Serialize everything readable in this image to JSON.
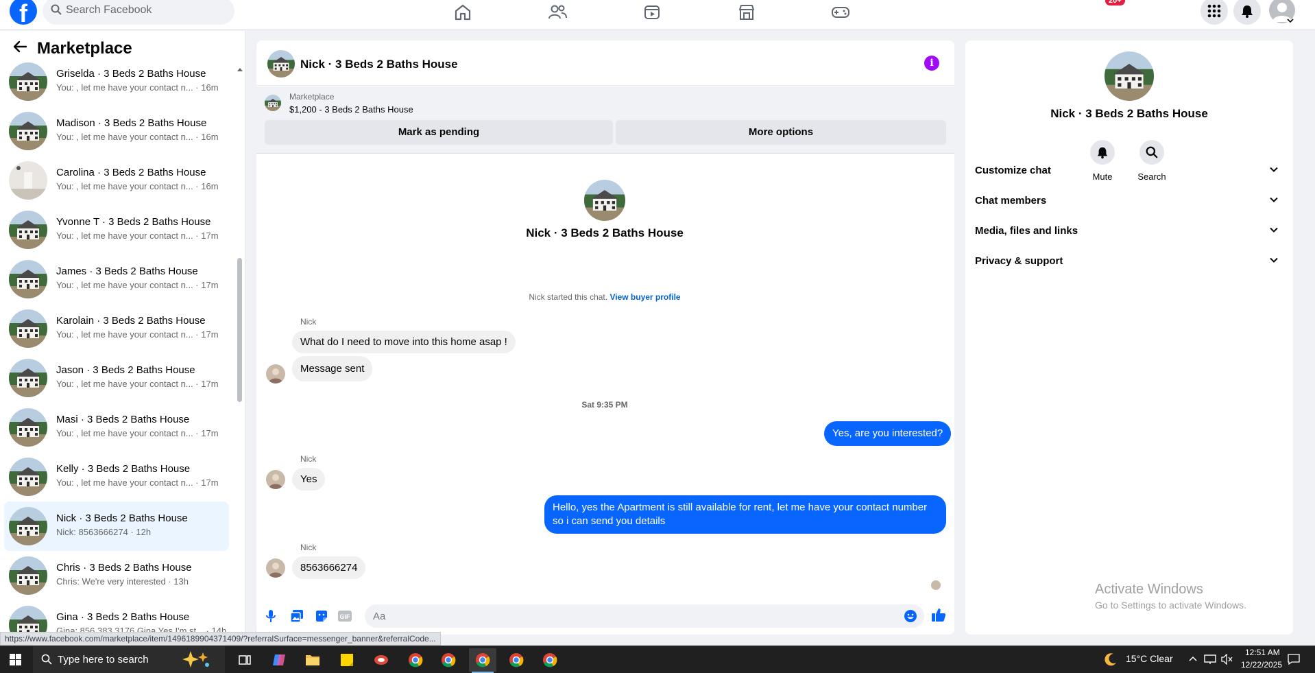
{
  "topbar": {
    "logo_letter": "f",
    "search_placeholder": "Search Facebook",
    "notification_badge": "20+",
    "nav_icons": [
      "home-icon",
      "friends-icon",
      "video-icon",
      "marketplace-icon",
      "gaming-icon"
    ]
  },
  "sidebar": {
    "title": "Marketplace",
    "conversations": [
      {
        "title": "Griselda · 3 Beds 2 Baths House",
        "subtitle": "You: , let me have your contact n... · 16m",
        "active": false
      },
      {
        "title": "Madison · 3 Beds 2 Baths House",
        "subtitle": "You: , let me have your contact n... · 16m",
        "active": false
      },
      {
        "title": "Carolina · 3 Beds 2 Baths House",
        "subtitle": "You: , let me have your contact n... · 16m",
        "active": false
      },
      {
        "title": "Yvonne T · 3 Beds 2 Baths House",
        "subtitle": "You: , let me have your contact n... · 17m",
        "active": false
      },
      {
        "title": "James · 3 Beds 2 Baths House",
        "subtitle": "You: , let me have your contact n... · 17m",
        "active": false
      },
      {
        "title": "Karolain · 3 Beds 2 Baths House",
        "subtitle": "You: , let me have your contact n... · 17m",
        "active": false
      },
      {
        "title": "Jason · 3 Beds 2 Baths House",
        "subtitle": "You: , let me have your contact n... · 17m",
        "active": false
      },
      {
        "title": "Masi · 3 Beds 2 Baths House",
        "subtitle": "You: , let me have your contact n... · 17m",
        "active": false
      },
      {
        "title": "Kelly · 3 Beds 2 Baths House",
        "subtitle": "You: , let me have your contact n... · 17m",
        "active": false
      },
      {
        "title": "Nick · 3 Beds 2 Baths House",
        "subtitle": "Nick: 8563666274 · 12h",
        "active": true
      },
      {
        "title": "Chris · 3 Beds 2 Baths House",
        "subtitle": "Chris: We're very interested · 13h",
        "active": false
      },
      {
        "title": "Gina · 3 Beds 2 Baths House",
        "subtitle": "Gina: 856 383 3176 Gina Yes I'm st... · 14h",
        "active": false
      }
    ]
  },
  "chat": {
    "title": "Nick · 3 Beds 2 Baths House",
    "listing_source": "Marketplace",
    "listing_price": "$1,200 - 3 Beds 2 Baths House",
    "mark_pending_label": "Mark as pending",
    "more_options_label": "More options",
    "intro_title": "Nick · 3 Beds 2 Baths House",
    "started_text": "Nick started this chat.",
    "view_buyer_label": "View buyer profile",
    "sender_name": "Nick",
    "msg1": "What do I need to move into this home asap !",
    "msg2": "Message sent",
    "time_separator": "Sat 9:35 PM",
    "msg3": "Yes, are you interested?",
    "msg4": "Yes",
    "msg5": "Hello, yes the Apartment is still available for rent, let me have your contact number so i can send you details",
    "msg6": "8563666274",
    "composer_placeholder": "Aa",
    "accent_color": "#0866ff"
  },
  "info_panel": {
    "title": "Nick · 3 Beds 2 Baths House",
    "mute_label": "Mute",
    "search_label": "Search",
    "sections": [
      "Customize chat",
      "Chat members",
      "Media, files and links",
      "Privacy & support"
    ]
  },
  "watermark": {
    "line1": "Activate Windows",
    "line2": "Go to Settings to activate Windows."
  },
  "status_url": "https://www.facebook.com/marketplace/item/1496189904371409/?referralSurface=messenger_banner&referralCode...",
  "taskbar": {
    "search_placeholder": "Type here to search",
    "weather": "15°C  Clear",
    "time": "12:51 AM",
    "date": "12/22/2025"
  }
}
